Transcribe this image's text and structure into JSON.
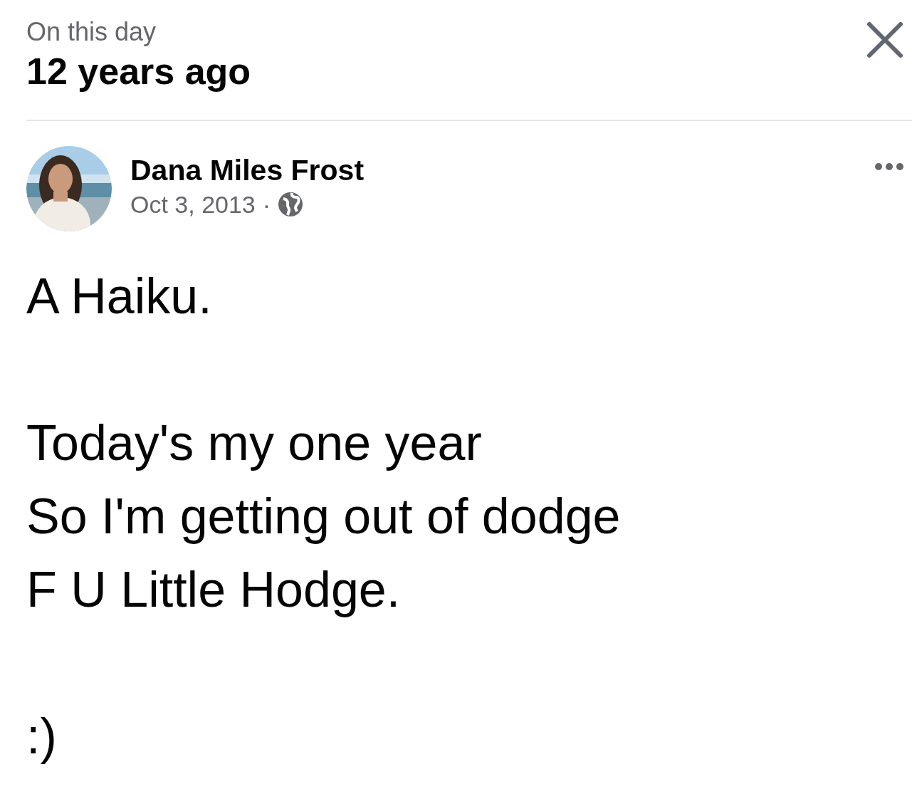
{
  "header": {
    "subtitle": "On this day",
    "title": "12 years ago"
  },
  "post": {
    "author": "Dana Miles Frost",
    "date": "Oct 3, 2013",
    "separator": "·",
    "body": "A Haiku.\n\nToday's my one year\nSo I'm getting out of dodge\nF U Little Hodge.\n\n:)"
  }
}
